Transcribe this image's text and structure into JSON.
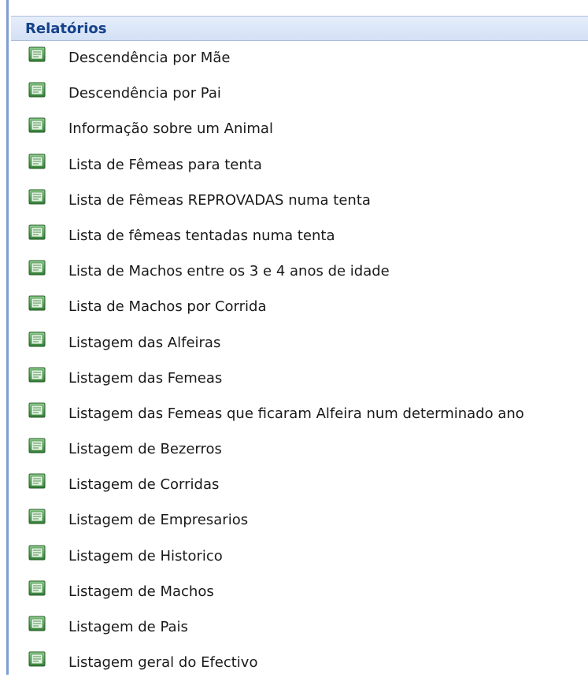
{
  "panel": {
    "title": "Relatórios",
    "items": [
      {
        "label": "Descendência por Mãe",
        "icon": "report-icon"
      },
      {
        "label": "Descendência por Pai",
        "icon": "report-icon"
      },
      {
        "label": "Informação sobre um Animal",
        "icon": "report-icon"
      },
      {
        "label": "Lista de Fêmeas para tenta",
        "icon": "report-icon"
      },
      {
        "label": "Lista de Fêmeas REPROVADAS numa tenta",
        "icon": "report-icon"
      },
      {
        "label": "Lista de fêmeas tentadas numa tenta",
        "icon": "report-icon"
      },
      {
        "label": "Lista de Machos entre os 3 e 4 anos de idade",
        "icon": "report-icon"
      },
      {
        "label": "Lista de Machos por Corrida",
        "icon": "report-icon"
      },
      {
        "label": "Listagem das Alfeiras",
        "icon": "report-icon"
      },
      {
        "label": "Listagem das Femeas",
        "icon": "report-icon"
      },
      {
        "label": "Listagem das Femeas que ficaram Alfeira num determinado ano",
        "icon": "report-icon"
      },
      {
        "label": "Listagem de Bezerros",
        "icon": "report-icon"
      },
      {
        "label": "Listagem de Corridas",
        "icon": "report-icon"
      },
      {
        "label": "Listagem de Empresarios",
        "icon": "report-icon"
      },
      {
        "label": "Listagem de Historico",
        "icon": "report-icon"
      },
      {
        "label": "Listagem de Machos",
        "icon": "report-icon"
      },
      {
        "label": "Listagem de Pais",
        "icon": "report-icon"
      },
      {
        "label": "Listagem geral do Efectivo",
        "icon": "report-icon"
      }
    ]
  },
  "colors": {
    "header_text": "#15428b",
    "header_bg": "#d3e0f5",
    "rule": "#7e9ed1",
    "icon_green": "#3c9a3c"
  }
}
